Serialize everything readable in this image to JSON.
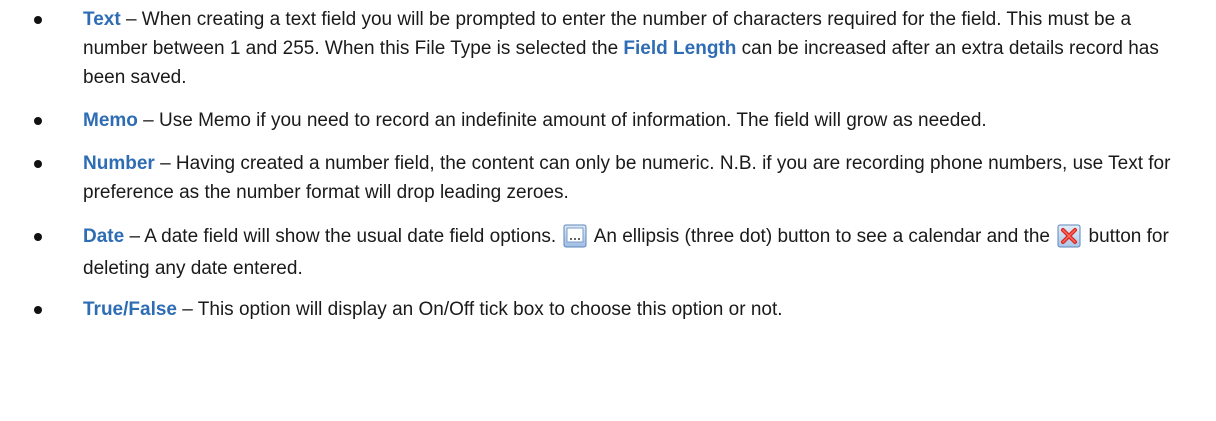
{
  "items": [
    {
      "term": "Text",
      "text1": " – When creating a text field you will be prompted to enter the number of characters required for the field.  This must be a number between 1 and 255. When this File Type is selected the ",
      "ref": "Field Length",
      "text2": " can be increased after an extra details record has been saved."
    },
    {
      "term": "Memo",
      "text1": " – Use Memo if you need to record an indefinite amount of information.  The field will grow as needed."
    },
    {
      "term": "Number",
      "text1": " – Having created a number field, the content can only be numeric.  N.B. if you are recording phone numbers, use Text for preference as the number format will drop leading zeroes."
    },
    {
      "term": "Date",
      "text1": " – A date field will show the usual date field options. ",
      "text2": " An ellipsis (three dot) button to see a calendar and the ",
      "text3": " button for deleting any date entered."
    },
    {
      "term": "True/False",
      "text1": " – This option will display an On/Off tick box to choose this option or not."
    }
  ],
  "icons": {
    "ellipsis": "ellipsis-button-icon",
    "delete": "delete-x-icon"
  },
  "colors": {
    "term": "#2e6db4",
    "text": "#1a1a1a"
  }
}
